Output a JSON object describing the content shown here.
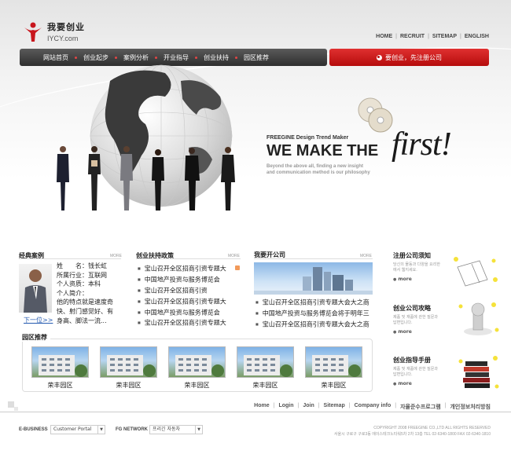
{
  "brand": {
    "cn_name": "我要创业",
    "domain": "IYCY.com",
    "logo_color": "#c8161d"
  },
  "top_links": [
    "HOME",
    "RECRUIT",
    "SITEMAP",
    "ENGLISH"
  ],
  "main_nav": [
    "网站首页",
    "创业起步",
    "案例分析",
    "开业指导",
    "创业扶持",
    "园区推荐"
  ],
  "cta": {
    "label": "要创业，先注册公司",
    "color": "#c8161d"
  },
  "hero": {
    "small": "FREEGINE Design Trend Maker",
    "big": "WE MAKE THE",
    "first": "first!",
    "desc_lines": [
      "Beyond the above all, finding a new insight",
      "and communication method is our philosophy"
    ]
  },
  "cases": {
    "title": "经典案例",
    "more": "MORE",
    "profile": [
      "姓　　名：钱长虹",
      "所属行业：互联网",
      "个人资质：本科",
      "个人简介：",
      "他的特点就是速度奇",
      "快、射门感觉好、有",
      "身高、脚法一流..."
    ],
    "next": "下一位>>"
  },
  "policy": {
    "title": "创业扶持政策",
    "more": "MORE",
    "items": [
      "宝山召开全区招商引资专题大",
      "中国地产投资与服务博览会",
      "宝山召开全区招商引资",
      "宝山召开全区招商引资专题大",
      "中国地产投资与服务博览会",
      "宝山召开全区招商引资专题大"
    ]
  },
  "company": {
    "title": "我要开公司",
    "more": "MORE",
    "items": [
      "宝山召开全区招商引资专题大会大之商",
      "中国地产投资与服务博览会将于明年三",
      "宝山召开全区招商引资专题大会大之商"
    ]
  },
  "parks": {
    "title": "园区推荐",
    "items": [
      "荣丰园区",
      "荣丰园区",
      "荣丰园区",
      "荣丰园区",
      "荣丰园区"
    ]
  },
  "side": [
    {
      "title": "注册公司须知",
      "desc": "당신의 물동과 다양을 요리한에서 웹지세요.",
      "more": "more"
    },
    {
      "title": "创业公司攻略",
      "desc": "제품 및 재품에 관한 질문과 답변입니다.",
      "more": "more"
    },
    {
      "title": "创业指导手册",
      "desc": "제품 및 재품에 관한 질문과 답변입니다.",
      "more": "more"
    }
  ],
  "footer": {
    "links": [
      "Home",
      "Login",
      "Join",
      "Sitemap",
      "Company info",
      "자율준수프로그램",
      "개인정보처리방침"
    ],
    "ebiz_label": "E-BUSINESS",
    "ebiz_value": "Customer Portal",
    "fg_label": "FG NETWORK",
    "fg_value": "프리긴 자동차",
    "copyright": "COPYRIGHT 2008 FREEGINE CO.,LTD ALL RIGHTS RESERVED",
    "address": "서울시 구로구 구로3동 에이스테크노타워5차 2차 13층 TEL 02-6340-1800 FAX 02-6340-1810"
  }
}
